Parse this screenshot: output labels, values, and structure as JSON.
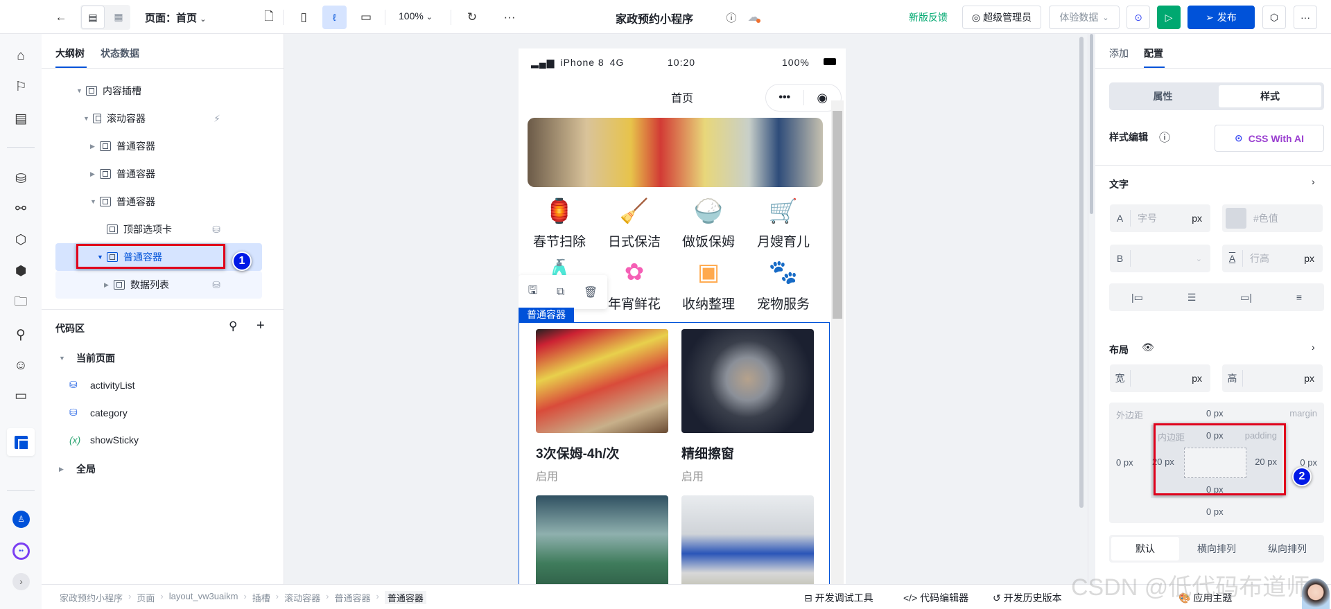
{
  "topbar": {
    "page_label": "页面：首页",
    "zoom": "100%",
    "app_title": "家政预约小程序",
    "feedback": "新版反馈",
    "user_role": "超级管理员",
    "data_mode": "体验数据",
    "publish": "发布",
    "accent": "#0052d9",
    "run_color": "#00a870"
  },
  "rail": {
    "icons": [
      "logo-icon",
      "home-icon",
      "flag-icon",
      "page-cart-icon",
      "database-icon",
      "link-icon",
      "slash-hex-icon",
      "hexagon-icon",
      "folder-cloud-icon",
      "tree-icon",
      "robot-icon",
      "id-card-icon",
      "layout-icon",
      "user-avatar-icon",
      "ai-assistant-icon",
      "expand-icon"
    ]
  },
  "tree": {
    "tabs": [
      "大纲树",
      "状态数据"
    ],
    "nodes": [
      {
        "label": "内容插槽"
      },
      {
        "label": "滚动容器"
      },
      {
        "label": "普通容器"
      },
      {
        "label": "普通容器"
      },
      {
        "label": "普通容器"
      },
      {
        "label": "顶部选项卡"
      },
      {
        "label": "普通容器",
        "selected": true
      },
      {
        "label": "数据列表"
      }
    ],
    "code_title": "代码区",
    "current_page": "当前页面",
    "code_items": [
      "activityList",
      "category",
      "showSticky"
    ],
    "global": "全局"
  },
  "annotations": {
    "badge1": "1",
    "badge2": "2"
  },
  "phone": {
    "device": "iPhone 8",
    "network": "4G",
    "time": "10:20",
    "battery": "100%",
    "nav_title": "首页",
    "grid": [
      {
        "label": "春节扫除",
        "icon": "lantern-icon",
        "color": "#f5001f"
      },
      {
        "label": "日式保洁",
        "icon": "bucket-mop-icon",
        "color": "#4fb7f5"
      },
      {
        "label": "做饭保姆",
        "icon": "rice-cooker-icon",
        "color": "#ff8a4c"
      },
      {
        "label": "月嫂育儿",
        "icon": "stroller-icon",
        "color": "#c061d8"
      },
      {
        "label": "",
        "icon": "bucket-icon",
        "color": "#4fb7f5"
      },
      {
        "label": "年宵鲜花",
        "icon": "flower-icon",
        "color": "#f55fb5"
      },
      {
        "label": "收纳整理",
        "icon": "storage-box-icon",
        "color": "#ffa94d"
      },
      {
        "label": "宠物服务",
        "icon": "paw-icon",
        "color": "#6fcf5b"
      }
    ],
    "selected_tag": "普通容器",
    "cards": [
      {
        "title": "3次保姆-4h/次",
        "status": "启用"
      },
      {
        "title": "精细擦窗",
        "status": "启用"
      },
      {
        "title": "",
        "status": ""
      },
      {
        "title": "",
        "status": ""
      }
    ]
  },
  "right": {
    "tabs": [
      "添加",
      "配置"
    ],
    "segments": [
      "属性",
      "样式"
    ],
    "style_edit": "样式编辑",
    "css_ai": "CSS With AI",
    "text_section": "文字",
    "font_size_ph": "字号",
    "unit": "px",
    "color_ph": "#色值",
    "line_height_ph": "行高",
    "layout_section": "布局",
    "width_label": "宽",
    "height_label": "高",
    "margin_label": "外边距",
    "margin_en": "margin",
    "padding_label": "内边距",
    "padding_en": "padding",
    "margin": {
      "top": "0 px",
      "right": "0 px",
      "bottom": "0 px",
      "left": "0 px"
    },
    "padding": {
      "top": "0 px",
      "right": "20 px",
      "bottom": "0 px",
      "left": "20 px"
    },
    "arrange": [
      "默认",
      "横向排列",
      "纵向排列"
    ]
  },
  "bottom": {
    "breadcrumb": [
      "家政预约小程序",
      "页面",
      "layout_vw3uaikm",
      "插槽",
      "滚动容器",
      "普通容器",
      "普通容器"
    ],
    "tools": [
      "开发调试工具",
      "代码编辑器",
      "开发历史版本",
      "应用主题"
    ]
  },
  "watermark": "CSDN @低代码布道师"
}
